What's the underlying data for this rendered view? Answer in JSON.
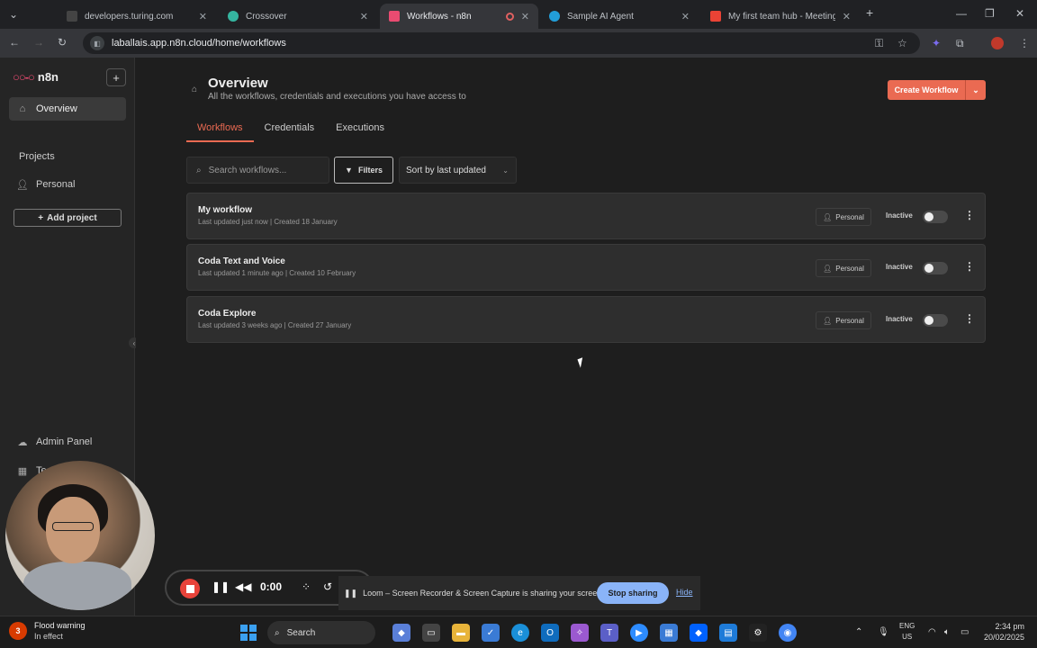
{
  "browser": {
    "tabs": [
      {
        "title": "developers.turing.com",
        "icon_color": "#444"
      },
      {
        "title": "Crossover",
        "icon_color": "#35b5a0"
      },
      {
        "title": "Workflows - n8n",
        "icon_color": "#ea4b71"
      },
      {
        "title": "Sample AI Agent",
        "icon_color": "#229ed9"
      },
      {
        "title": "My first team hub - Meeting no",
        "icon_color": "#ea4335"
      }
    ],
    "url": "laballais.app.n8n.cloud/home/workflows"
  },
  "sidebar": {
    "brand": "n8n",
    "overview": "Overview",
    "projects_heading": "Projects",
    "personal": "Personal",
    "add_project": "Add project",
    "admin_panel": "Admin Panel",
    "partial_item": "Te"
  },
  "header": {
    "title": "Overview",
    "subtitle": "All the workflows, credentials and executions you have access to",
    "create_button": "Create Workflow"
  },
  "tabs": [
    "Workflows",
    "Credentials",
    "Executions"
  ],
  "toolbar": {
    "search_placeholder": "Search workflows...",
    "filters": "Filters",
    "sort": "Sort by last updated"
  },
  "workflows": [
    {
      "name": "My workflow",
      "meta": "Last updated just now | Created 18 January",
      "owner": "Personal",
      "status": "Inactive",
      "active": false
    },
    {
      "name": "Coda Text and Voice",
      "meta": "Last updated 1 minute ago | Created 10 February",
      "owner": "Personal",
      "status": "Inactive",
      "active": false
    },
    {
      "name": "Coda Explore",
      "meta": "Last updated 3 weeks ago | Created 27 January",
      "owner": "Personal",
      "status": "Inactive",
      "active": false
    }
  ],
  "loom": {
    "timer": "0:00",
    "message": "Loom – Screen Recorder & Screen Capture is sharing your screen.",
    "stop_sharing": "Stop sharing",
    "hide": "Hide"
  },
  "taskbar": {
    "weather_badge": "3",
    "weather_title": "Flood warning",
    "weather_sub": "In effect",
    "search": "Search",
    "lang_line1": "ENG",
    "lang_line2": "US",
    "time": "2:34 pm",
    "date": "20/02/2025"
  },
  "colors": {
    "accent": "#ea6a52",
    "n8n_brand": "#ea4b71",
    "stop_share": "#8ab4f8"
  }
}
